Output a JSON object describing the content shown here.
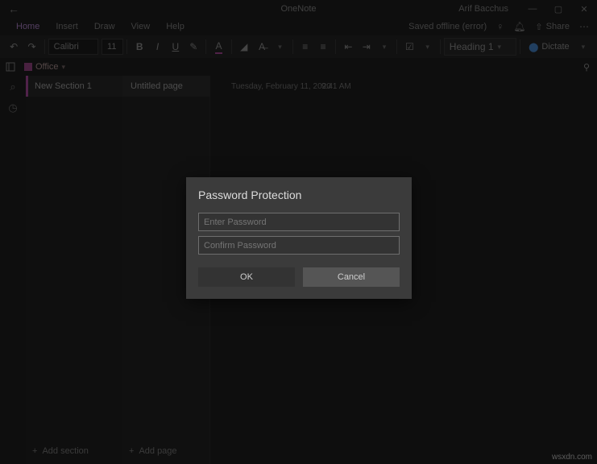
{
  "titlebar": {
    "app_name": "OneNote",
    "user": "Arif Bacchus"
  },
  "tabs": {
    "home": "Home",
    "insert": "Insert",
    "draw": "Draw",
    "view": "View",
    "help": "Help",
    "status": "Saved offline (error)",
    "share": "Share"
  },
  "toolbar": {
    "font": "Calibri",
    "font_size": "11",
    "heading": "Heading 1",
    "dictate": "Dictate"
  },
  "navrow": {
    "notebook": "Office"
  },
  "sections": {
    "item1": "New Section 1",
    "add": "Add section"
  },
  "pages": {
    "item1": "Untitled page",
    "add": "Add page"
  },
  "content": {
    "date": "Tuesday, February 11, 2020",
    "time": "9:41 AM"
  },
  "dialog": {
    "title": "Password Protection",
    "enter_placeholder": "Enter Password",
    "confirm_placeholder": "Confirm Password",
    "ok": "OK",
    "cancel": "Cancel"
  },
  "watermark": "wsxdn.com"
}
